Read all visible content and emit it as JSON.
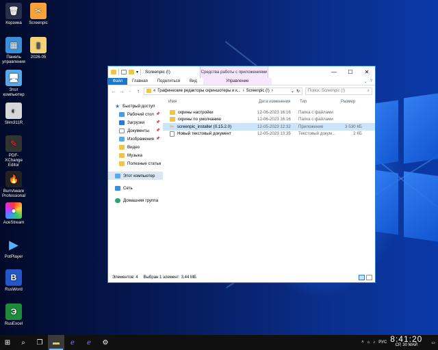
{
  "desktop": {
    "icons": [
      {
        "label": "Корзина",
        "icon": "recycle-bin-icon"
      },
      {
        "label": "Screenpic",
        "icon": "screenpic-icon"
      },
      {
        "label": "Панель управления",
        "icon": "control-panel-icon"
      },
      {
        "label": "2026-05",
        "icon": "zip-folder-icon"
      },
      {
        "label": "Этот компьютер",
        "icon": "computer-icon"
      },
      {
        "label": "Slim311R",
        "icon": "slim-icon"
      },
      {
        "label": "PDF-XChange Editor",
        "icon": "pdf-icon"
      },
      {
        "label": "BurnAware Professional",
        "icon": "burnaware-icon"
      },
      {
        "label": "AceStream",
        "icon": "acestream-icon"
      },
      {
        "label": "PotPlayer",
        "icon": "potplayer-icon"
      },
      {
        "label": "RusWord",
        "icon": "rusword-icon"
      },
      {
        "label": "RusExcel",
        "icon": "rusexcel-icon"
      }
    ]
  },
  "window": {
    "title": "Screenpic (!)",
    "context_tab_group": "Средства работы с приложениями",
    "ribbon": {
      "file": "Файл",
      "tabs": [
        "Главная",
        "Поделиться",
        "Вид"
      ],
      "context_tab": "Управление"
    },
    "address": {
      "prefix": "«",
      "crumbs": [
        "Графические редакторы скриншотеры и к...",
        "Screenpic (!)"
      ],
      "search_placeholder": "Поиск: Screenpic (!)"
    },
    "nav": {
      "quick_access": "Быстрый доступ",
      "pinned": [
        "Рабочий стол",
        "Загрузки",
        "Документы",
        "Изображения"
      ],
      "folders": [
        "Видео",
        "Музыка",
        "Полезные статьи"
      ],
      "this_pc": "Этот компьютер",
      "network": "Сеть",
      "homegroup": "Домашняя группа"
    },
    "columns": {
      "name": "Имя",
      "date": "Дата изменения",
      "type": "Тип",
      "size": "Размер"
    },
    "files": [
      {
        "name": "скрины настройки",
        "date": "12-06-2023 16:16",
        "type": "Папка с файлами",
        "size": ""
      },
      {
        "name": "скрины по умолчанию",
        "date": "12-06-2023 16:16",
        "type": "Папка с файлами",
        "size": ""
      },
      {
        "name": "screenpic_installer (0.15.2.0)",
        "date": "12-05-2023 12:32",
        "type": "Приложение",
        "size": "3 530 КБ"
      },
      {
        "name": "Новый текстовый документ",
        "date": "12-05-2023 13:35",
        "type": "Текстовый докум...",
        "size": "2 КБ"
      }
    ],
    "status": {
      "count": "Элементов: 4",
      "selection": "Выбран 1 элемент: 3,44 МБ"
    }
  },
  "taskbar": {
    "lang": "РУС",
    "time": "8:41:20",
    "date": "СР, 30 МАЙ"
  },
  "colors": {
    "accent": "#1979ca",
    "folder": "#f0c44a",
    "selection": "#cce4f7",
    "taskbar": "#101010"
  }
}
